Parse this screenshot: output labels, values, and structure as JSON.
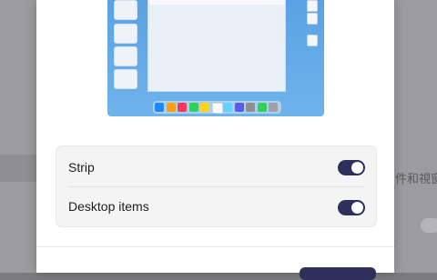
{
  "background": {
    "partial_text": "件和視窗"
  },
  "preview": {
    "dock_colors": [
      "#1e88ff",
      "#ff9f0a",
      "#ff375f",
      "#30d158",
      "#ffd60a",
      "#ffffff",
      "#64d2ff",
      "#5e5ce6",
      "#8e8e93",
      "#30d158",
      "#a0a0a5"
    ]
  },
  "settings": {
    "strip_label": "Strip",
    "strip_on": true,
    "desktop_items_label": "Desktop items",
    "desktop_items_on": true
  },
  "colors": {
    "toggle_on": "#2e2f5a",
    "preview_bg": "#5aa2e3"
  }
}
